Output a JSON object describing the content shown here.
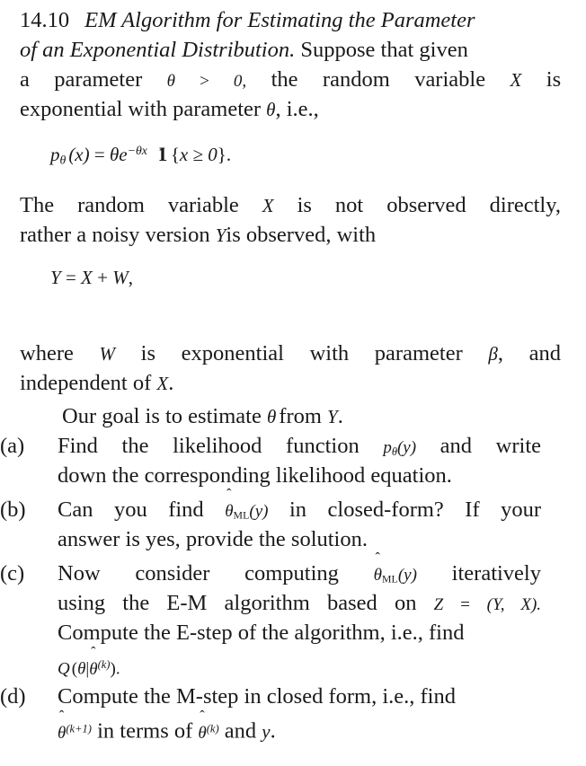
{
  "document": {
    "kind": "textbook-exercise",
    "problem_number": "14.10",
    "title_italic": "EM Algorithm for Estimating the Parameter of an Exponential Distribution.",
    "background_color": "#ffffff",
    "text_color": "#1a1a1a"
  },
  "intro": {
    "line1_number": "14.10",
    "line1_title": "EM Algorithm for Estimating the Parameter",
    "line2_title": "of an Exponential Distribution.",
    "line2_rest": "Suppose that given",
    "line3_w1": "a",
    "line3_w2": "parameter",
    "line3_math": "θ > 0,",
    "line3_w3": "the",
    "line3_w4": "random",
    "line3_w5": "variable",
    "line3_math2": "X",
    "line3_w6": "is",
    "line4": "exponential with parameter",
    "line4_math": "θ",
    "line4_tail": ", i.e.,"
  },
  "equation1": {
    "lhs_p": "p",
    "lhs_sub": "θ",
    "lhs_arg": "(x)",
    "eq": "=",
    "theta": "θ",
    "e": "e",
    "exp": "−θx",
    "indicator_open": "{",
    "indicator_body": "x ≥ 0",
    "indicator_close": "}",
    "period": "."
  },
  "paragraph2": {
    "line1": "The random variable",
    "line1_math": "X",
    "line1_rest": "is not observed directly,",
    "line2": "rather a noisy version",
    "line2_math": "Y",
    "line2_rest": "is observed, with"
  },
  "equation2": {
    "text": "Y = X + W,",
    "y": "Y",
    "eq": "=",
    "x": "X",
    "plus": "+",
    "w": "W",
    "comma": ","
  },
  "paragraph3": {
    "line1_a": "where",
    "line1_math": "W",
    "line1_b": "is exponential with parameter",
    "line1_math2": "β",
    "line1_c": ", and",
    "line2_a": "independent of",
    "line2_math": "X",
    "line2_b": "."
  },
  "goal": {
    "text_a": "Our goal is to estimate",
    "math": "θ",
    "text_b": "from",
    "math2": "Y",
    "text_c": "."
  },
  "items": [
    {
      "marker": "(a)",
      "line1_a": "Find the likelihood function",
      "line1_math": "p",
      "line1_math_sub": "θ",
      "line1_math_arg": "(y)",
      "line1_b": "and write",
      "line2": "down the corresponding likelihood equation."
    },
    {
      "marker": "(b)",
      "line1_a": "Can you find",
      "line1_math_theta": "θ",
      "line1_math_sub": "ML",
      "line1_math_arg": "(y)",
      "line1_b": "in closed-form? If your",
      "line2": "answer is yes, provide the solution."
    },
    {
      "marker": "(c)",
      "line1_a": "Now",
      "line1_b": "consider",
      "line1_c": "computing",
      "line1_math_theta": "θ",
      "line1_math_sub": "ML",
      "line1_math_arg": "(y)",
      "line1_d": "iteratively",
      "line2_a": "using",
      "line2_b": "the",
      "line2_c": "E-M",
      "line2_d": "algorithm",
      "line2_e": "based",
      "line2_f": "on",
      "line2_math": "Z = (Y, X).",
      "line3": "Compute the E-step of the algorithm, i.e., find",
      "line4_q": "Q",
      "line4_open": "(",
      "line4_theta": "θ",
      "line4_bar": "|",
      "line4_theta_hat": "θ",
      "line4_sup": "(k)",
      "line4_close": ")",
      "line4_period": "."
    },
    {
      "marker": "(d)",
      "line1": "Compute the M-step in closed form, i.e., find",
      "line2_theta": "θ",
      "line2_sup": "(k+1)",
      "line2_a": "in terms of",
      "line2_theta2": "θ",
      "line2_sup2": "(k)",
      "line2_b": "and",
      "line2_y": "y",
      "line2_c": "."
    }
  ]
}
